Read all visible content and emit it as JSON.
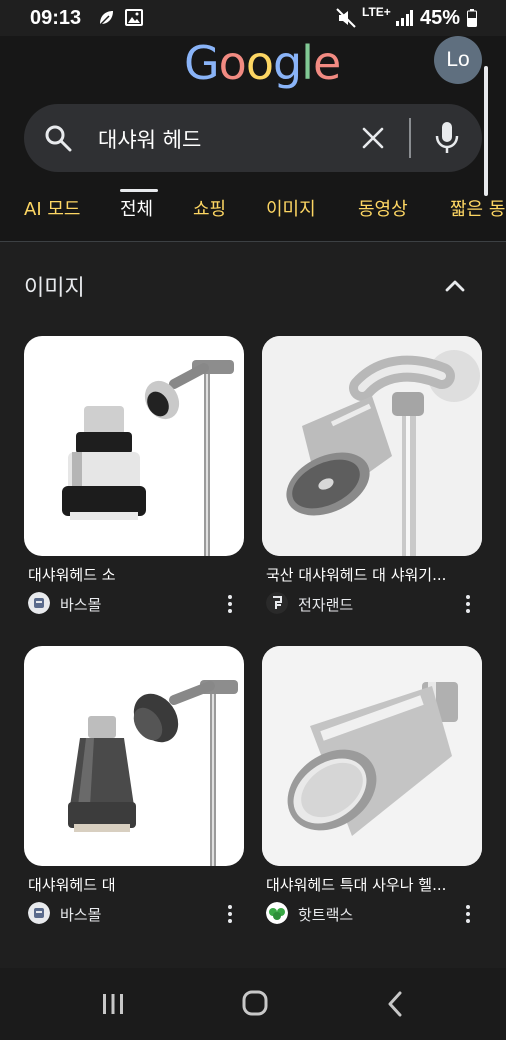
{
  "status_bar": {
    "time": "09:13",
    "network": "LTE+",
    "battery": "45%",
    "icons": [
      "leaf-icon",
      "gallery-icon",
      "mute-icon",
      "signal-icon",
      "battery-icon"
    ]
  },
  "header": {
    "logo": {
      "letters": [
        "G",
        "o",
        "o",
        "g",
        "l",
        "e"
      ]
    },
    "avatar": "Lo",
    "search": {
      "query": "대샤워 헤드"
    }
  },
  "tabs": [
    {
      "label": "AI 모드",
      "active": false
    },
    {
      "label": "전체",
      "active": true
    },
    {
      "label": "쇼핑",
      "active": false
    },
    {
      "label": "이미지",
      "active": false
    },
    {
      "label": "동영상",
      "active": false
    },
    {
      "label": "짧은 동",
      "active": false
    }
  ],
  "images_section": {
    "title": "이미지",
    "results": [
      {
        "caption": "대샤워헤드 소",
        "source": "바스몰"
      },
      {
        "caption": "국산 대샤워헤드 대 샤워기...",
        "source": "전자랜드"
      },
      {
        "caption": "대샤워헤드 대",
        "source": "바스몰"
      },
      {
        "caption": "대샤워헤드 특대 사우나 헬...",
        "source": "핫트랙스"
      }
    ]
  },
  "colors": {
    "background": "#1f1f1f",
    "tab_accent": "#fdd663",
    "searchbox": "#2f3033",
    "text": "#e8eaed"
  }
}
